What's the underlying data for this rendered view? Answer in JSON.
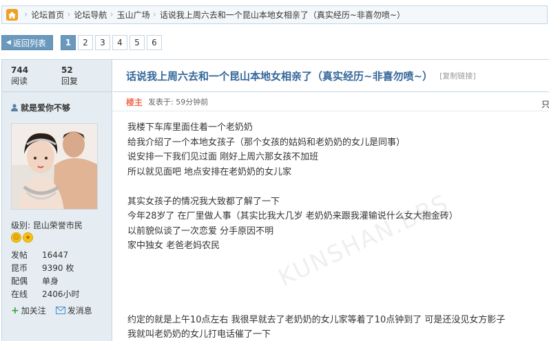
{
  "breadcrumb": {
    "items": [
      "论坛首页",
      "论坛导航",
      "玉山广场"
    ],
    "current": "话说我上周六去和一个昆山本地女相亲了（真实经历~非喜勿喷~）"
  },
  "pager": {
    "back_label": "返回列表",
    "pages": [
      "1",
      "2",
      "3",
      "4",
      "5",
      "6"
    ],
    "current_page": "1"
  },
  "stats": {
    "views": "744",
    "views_label": "阅读",
    "replies": "52",
    "replies_label": "回复"
  },
  "thread": {
    "title": "话说我上周六去和一个昆山本地女相亲了（真实经历~非喜勿喷~）",
    "copy_link": "[复制链接]"
  },
  "author": {
    "name": "就是爱你不够",
    "level_label": "级别:",
    "level": "昆山荣誉市民",
    "posts_label": "发帖",
    "posts": "16447",
    "coins_label": "昆币",
    "coins": "9390 枚",
    "spouse_label": "配偶",
    "spouse": "单身",
    "online_label": "在线",
    "online": "2406小时",
    "add_follow": "加关注",
    "send_msg": "发消息"
  },
  "post": {
    "role": "楼主",
    "time": "发表于: 59分钟前",
    "only_see": "只",
    "watermark": "KUNSHAN.BBS",
    "lines": [
      "我楼下车库里面住着一个老奶奶",
      "给我介绍了一个本地女孩子（那个女孩的姑妈和老奶奶的女儿是同事）",
      "说安排一下我们见过面  刚好上周六那女孩不加班",
      "所以就见面吧  地点安排在老奶奶的女儿家",
      "",
      "其实女孩子的情况我大致都了解了一下",
      "今年28岁了  在厂里做人事（其实比我大几岁  老奶奶来跟我灌输说什么女大抱金砖）",
      "以前貌似谈了一次恋爱  分手原因不明",
      "家中独女  老爸老妈农民",
      "",
      "",
      "",
      "",
      "约定的就是上午10点左右  我很早就去了老奶奶的女儿家等着了10点钟到了  可是还没见女方影子",
      "我就叫老奶奶的女儿打电话催了一下"
    ]
  }
}
